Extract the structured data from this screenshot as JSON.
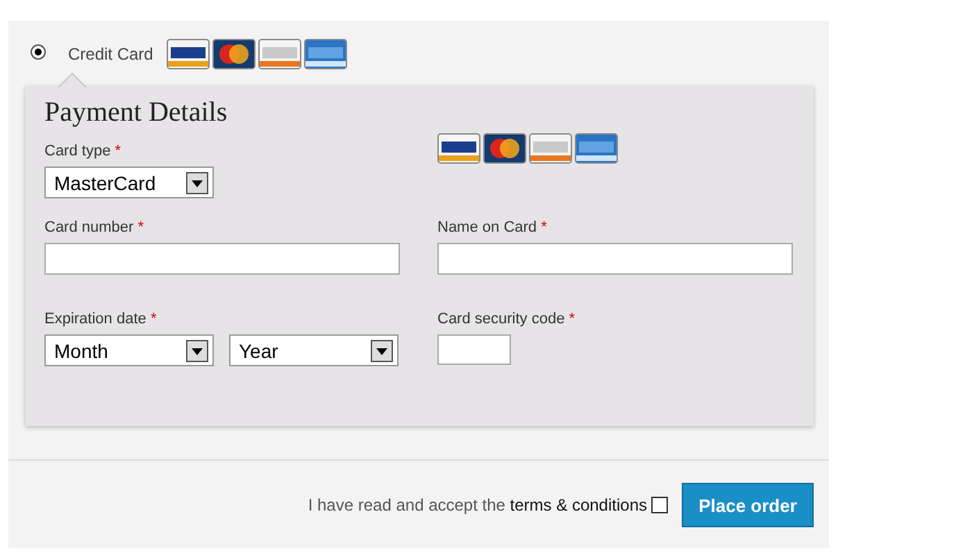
{
  "payment_method": {
    "label": "Credit Card",
    "selected": true
  },
  "details": {
    "title": "Payment Details",
    "fields": [
      {
        "kind": "select",
        "label": "Card type",
        "mark": "*",
        "value": "MasterCard"
      },
      {
        "kind": "text",
        "label": "Card number",
        "mark": "*"
      },
      {
        "kind": "text",
        "label": "Name on Card",
        "mark": "*"
      },
      {
        "kind": "select-pair",
        "label": "Expiration date",
        "mark": "*",
        "values": [
          "Month",
          "Year"
        ]
      },
      {
        "kind": "short",
        "label": "Card security code",
        "mark": "*"
      }
    ]
  },
  "terms": {
    "text": "I have read and accept the",
    "link": "terms & conditions",
    "checked": false
  },
  "button": "Place order"
}
